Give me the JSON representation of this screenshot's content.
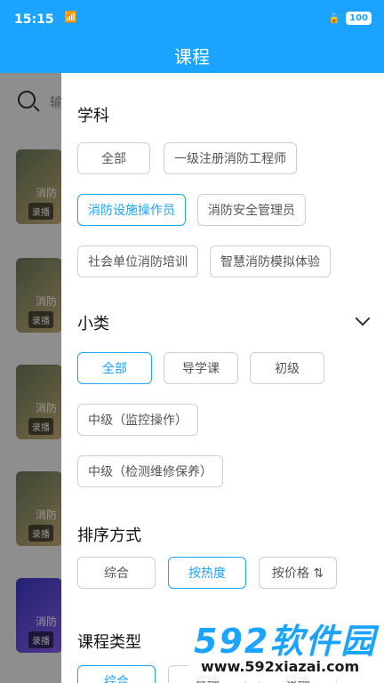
{
  "status": {
    "time": "15:15",
    "battery": "100"
  },
  "header": {
    "title": "课程"
  },
  "search": {
    "placeholder": "输"
  },
  "list": {
    "tags": [
      "录播",
      "录播",
      "录播",
      "录播",
      "录播"
    ],
    "mini_text": [
      "消防",
      "消防",
      "消防",
      "消防",
      "消防"
    ]
  },
  "filters": {
    "subject": {
      "title": "学科",
      "options": [
        "全部",
        "一级注册消防工程师",
        "消防设施操作员",
        "消防安全管理员",
        "社会单位消防培训",
        "智慧消防模拟体验"
      ],
      "selected": "消防设施操作员"
    },
    "subcategory": {
      "title": "小类",
      "options": [
        "全部",
        "导学课",
        "初级",
        "中级（监控操作）",
        "中级（检测维修保养）"
      ],
      "selected": "全部"
    },
    "sort": {
      "title": "排序方式",
      "options": [
        "综合",
        "按热度",
        "按价格 ⇅"
      ],
      "selected": "按热度"
    },
    "course_type": {
      "title": "课程类型",
      "options": [
        "综合",
        "直播",
        "录播"
      ],
      "selected": "综合"
    }
  },
  "watermark": {
    "brand": "592软件园",
    "url": "www.592xiazai.com"
  },
  "colors": {
    "accent": "#1aa3ff"
  }
}
